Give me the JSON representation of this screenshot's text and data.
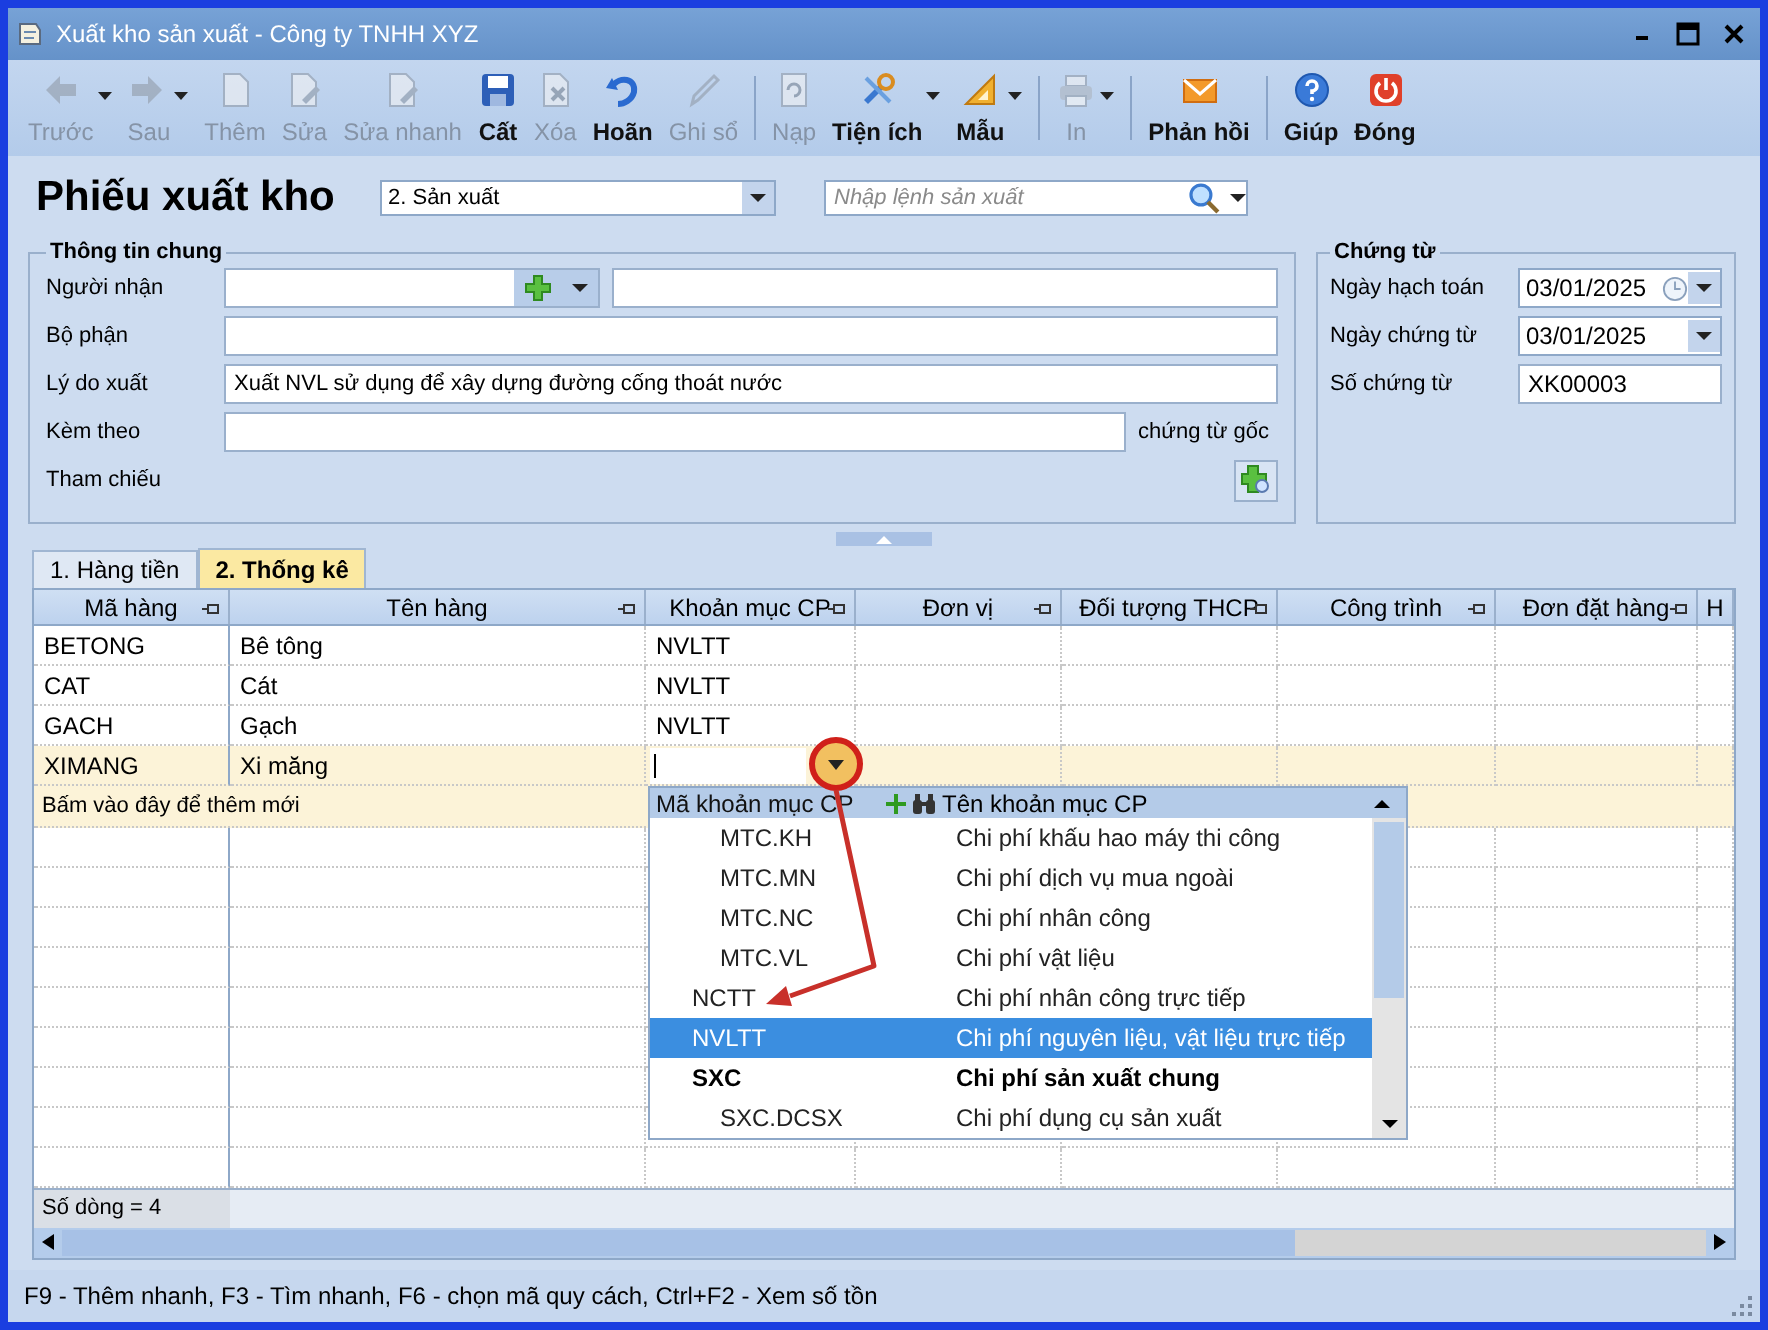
{
  "window": {
    "title": "Xuất kho sản xuất - Công ty TNHH XYZ"
  },
  "toolbar": [
    {
      "kind": "button",
      "label": "Trước",
      "disabled": true,
      "dropdown": true
    },
    {
      "kind": "button",
      "label": "Sau",
      "disabled": true,
      "dropdown": true
    },
    {
      "kind": "button",
      "label": "Thêm",
      "disabled": true,
      "dropdown": false
    },
    {
      "kind": "button",
      "label": "Sửa",
      "disabled": true,
      "dropdown": false
    },
    {
      "kind": "button",
      "label": "Sửa nhanh",
      "disabled": true,
      "dropdown": false
    },
    {
      "kind": "button",
      "label": "Cất",
      "disabled": false,
      "dropdown": false
    },
    {
      "kind": "button",
      "label": "Xóa",
      "disabled": true,
      "dropdown": false
    },
    {
      "kind": "button",
      "label": "Hoãn",
      "disabled": false,
      "dropdown": false
    },
    {
      "kind": "button",
      "label": "Ghi sổ",
      "disabled": true,
      "dropdown": false
    },
    {
      "kind": "separator"
    },
    {
      "kind": "button",
      "label": "Nạp",
      "disabled": true,
      "dropdown": false
    },
    {
      "kind": "button",
      "label": "Tiện ích",
      "disabled": false,
      "dropdown": true
    },
    {
      "kind": "button",
      "label": "Mẫu",
      "disabled": false,
      "dropdown": true
    },
    {
      "kind": "separator"
    },
    {
      "kind": "button",
      "label": "In",
      "disabled": true,
      "dropdown": true
    },
    {
      "kind": "separator"
    },
    {
      "kind": "button",
      "label": "Phản hồi",
      "disabled": false,
      "dropdown": false
    },
    {
      "kind": "separator"
    },
    {
      "kind": "button",
      "label": "Giúp",
      "disabled": false,
      "dropdown": false
    },
    {
      "kind": "button",
      "label": "Đóng",
      "disabled": false,
      "dropdown": false
    }
  ],
  "header": {
    "title": "Phiếu xuất kho",
    "voucher_type": "2. Sản xuất",
    "search": {
      "placeholder": "Nhập lệnh sản xuất"
    }
  },
  "general_info": {
    "title": "Thông tin chung",
    "fields": [
      {
        "label": "Người nhận",
        "kind": "lookup"
      },
      {
        "label": "Bộ phận",
        "kind": "text"
      },
      {
        "label": "Lý do xuất",
        "kind": "text",
        "value": "Xuất NVL sử dụng để xây dựng đường cống thoát nước"
      },
      {
        "label": "Kèm theo",
        "kind": "attach",
        "suffix": "chứng từ gốc"
      },
      {
        "label": "Tham chiếu",
        "kind": "reference"
      }
    ]
  },
  "voucher": {
    "title": "Chứng từ",
    "fields": [
      {
        "label": "Ngày hạch toán",
        "kind": "date_clock",
        "value": "03/01/2025"
      },
      {
        "label": "Ngày chứng từ",
        "kind": "date",
        "value": "03/01/2025"
      },
      {
        "label": "Số chứng từ",
        "kind": "text",
        "value": "XK00003"
      }
    ]
  },
  "tabs": [
    {
      "label": "1. Hàng tiền",
      "selected": false
    },
    {
      "label": "2. Thống kê",
      "selected": true
    }
  ],
  "grid": {
    "columns": [
      "Mã hàng",
      "Tên hàng",
      "Khoản mục CP",
      "Đơn vị",
      "Đối tượng THCP",
      "Công trình",
      "Đơn đặt hàng",
      "H"
    ],
    "rows": [
      {
        "cells": [
          "BETONG",
          "Bê tông",
          "NVLTT"
        ],
        "selected": false
      },
      {
        "cells": [
          "CAT",
          "Cát",
          "NVLTT"
        ],
        "selected": false
      },
      {
        "cells": [
          "GACH",
          "Gạch",
          "NVLTT"
        ],
        "selected": false
      },
      {
        "cells": [
          "XIMANG",
          "Xi măng"
        ],
        "selected": true
      }
    ],
    "new_row_hint": "Bấm vào đây để thêm mới",
    "footer": "Số dòng = 4"
  },
  "dropdown": {
    "headers": [
      "Mã khoản mục CP",
      "Tên khoản mục CP"
    ],
    "rows": [
      {
        "children": [
          {
            "code": "MTC.KH",
            "name": "Chi phí khấu hao máy thi công",
            "selected": false
          },
          {
            "code": "MTC.MN",
            "name": "Chi phí dịch vụ mua ngoài",
            "selected": false
          },
          {
            "code": "MTC.NC",
            "name": "Chi phí nhân công",
            "selected": false
          },
          {
            "code": "MTC.VL",
            "name": "Chi phí vật liệu",
            "selected": false
          }
        ]
      },
      {
        "code": "NCTT",
        "name": "Chi phí nhân công trực tiếp",
        "selected": false
      },
      {
        "code": "NVLTT",
        "name": "Chi phí nguyên liệu, vật liệu trực tiếp",
        "selected": true
      },
      {
        "code": "SXC",
        "name": "Chi phí sản xuất chung",
        "selected": false,
        "children": [
          {
            "code": "SXC.DCSX",
            "name": "Chi phí dụng cụ sản xuất",
            "selected": false
          }
        ]
      }
    ]
  },
  "status_bar": "F9 - Thêm nhanh, F3 - Tìm nhanh, F6 - chọn mã quy cách, Ctrl+F2 - Xem số tồn"
}
